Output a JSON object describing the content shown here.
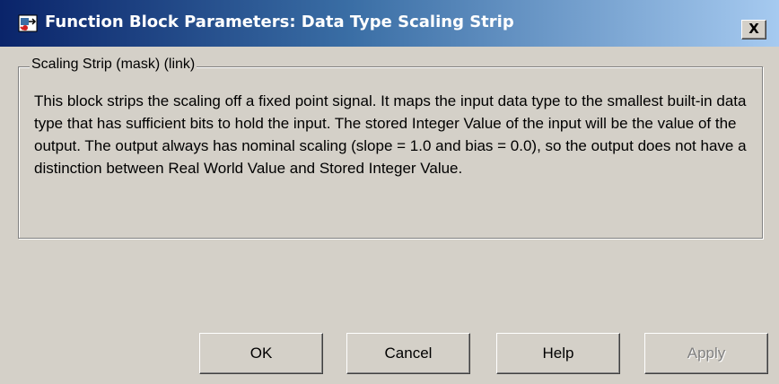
{
  "window": {
    "title": "Function Block Parameters: Data Type Scaling Strip",
    "icon": "simulink-block-icon",
    "close_label": "X"
  },
  "group": {
    "legend": "Scaling Strip (mask) (link)",
    "description": "This block strips the scaling off a fixed point signal.  It maps the input data type to the smallest built-in data type that has sufficient bits to hold the input.  The stored Integer Value of the input will be the value of the output.  The output always has nominal scaling (slope = 1.0 and bias = 0.0), so the output does not have a distinction between Real World Value and Stored Integer Value."
  },
  "buttons": {
    "ok": "OK",
    "cancel": "Cancel",
    "help": "Help",
    "apply": "Apply"
  },
  "colors": {
    "titlebar_start": "#0a246a",
    "titlebar_end": "#a6caf0",
    "dialog_bg": "#d4d0c8"
  }
}
